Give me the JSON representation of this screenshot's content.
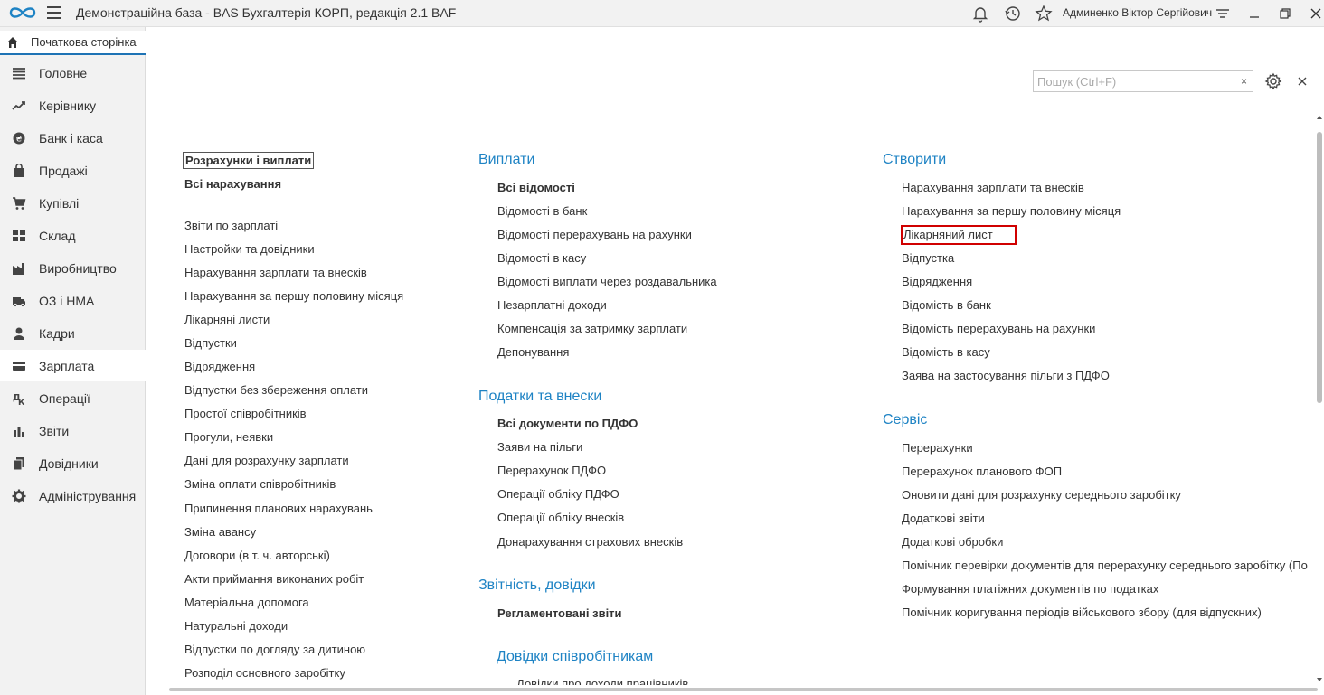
{
  "window": {
    "title": "Демонстраційна база - BAS Бухгалтерія КОРП, редакція 2.1 BAF",
    "user": "Админенко Віктор Сергійович"
  },
  "icons": {
    "logo": "bas-logo-icon",
    "menu": "hamburger-icon",
    "bell": "bell-icon",
    "history": "history-icon",
    "favorites": "star-icon",
    "user_menu": "filter-menu-icon",
    "minimize": "minimize-icon",
    "restore": "restore-icon",
    "close": "close-icon"
  },
  "colors": {
    "accent": "#1e83c4",
    "highlight": "#d00000"
  },
  "sidebar": {
    "home": "Початкова сторінка",
    "items": [
      {
        "label": "Головне",
        "icon": "list-icon"
      },
      {
        "label": "Керівнику",
        "icon": "trend-icon"
      },
      {
        "label": "Банк і каса",
        "icon": "coin-icon"
      },
      {
        "label": "Продажі",
        "icon": "bag-icon"
      },
      {
        "label": "Купівлі",
        "icon": "cart-icon"
      },
      {
        "label": "Склад",
        "icon": "grid-icon"
      },
      {
        "label": "Виробництво",
        "icon": "factory-icon"
      },
      {
        "label": "ОЗ і НМА",
        "icon": "truck-icon"
      },
      {
        "label": "Кадри",
        "icon": "person-icon"
      },
      {
        "label": "Зарплата",
        "icon": "wallet-icon"
      },
      {
        "label": "Операції",
        "icon": "operations-icon"
      },
      {
        "label": "Звіти",
        "icon": "barchart-icon"
      },
      {
        "label": "Довідники",
        "icon": "books-icon"
      },
      {
        "label": "Адміністрування",
        "icon": "gear-icon"
      }
    ]
  },
  "search": {
    "placeholder": "Пошук (Ctrl+F)",
    "clear": "×"
  },
  "col1": {
    "title": "Розрахунки і виплати",
    "bold_link": "Всі нарахування",
    "links": [
      "Звіти по зарплаті",
      "Настройки та довідники",
      "Нарахування зарплати та внесків",
      "Нарахування за першу половину місяця",
      "Лікарняні листи",
      "Відпустки",
      "Відрядження",
      "Відпустки без збереження оплати",
      "Простої співробітників",
      "Прогули, неявки",
      "Дані для розрахунку зарплати",
      "Зміна оплати співробітників",
      "Припинення планових нарахувань",
      "Зміна авансу",
      "Договори (в т. ч. авторські)",
      "Акти приймання виконаних робіт",
      "Матеріальна допомога",
      "Натуральні доходи",
      "Відпустки по догляду за дитиною",
      "Розподіл основного заробітку"
    ]
  },
  "col2": {
    "payments": {
      "title": "Виплати",
      "bold_link": "Всі відомості",
      "links": [
        "Відомості в банк",
        "Відомості перерахувань на рахунки",
        "Відомості в касу",
        "Відомості виплати через роздавальника",
        "Незарплатні доходи",
        "Компенсація за затримку зарплати",
        "Депонування"
      ]
    },
    "taxes": {
      "title": "Податки та внески",
      "bold_link": "Всі документи по ПДФО",
      "links": [
        "Заяви на пільги",
        "Перерахунок ПДФО",
        "Операції обліку ПДФО",
        "Операції обліку внесків",
        "Донарахування страхових внесків"
      ]
    },
    "reports": {
      "title": "Звітність, довідки",
      "bold_link": "Регламентовані звіти"
    },
    "certificates": {
      "title": "Довідки співробітникам",
      "links": [
        "Довідки про доходи працівників"
      ]
    }
  },
  "col3": {
    "create": {
      "title": "Створити",
      "links": [
        "Нарахування зарплати та внесків",
        "Нарахування за першу половину місяця",
        "Лікарняний лист",
        "Відпустка",
        "Відрядження",
        "Відомість в банк",
        "Відомість перерахувань на рахунки",
        "Відомість в касу",
        "Заява на застосування пільги з ПДФО"
      ]
    },
    "service": {
      "title": "Сервіс",
      "links": [
        "Перерахунки",
        "Перерахунок планового ФОП",
        "Оновити дані для розрахунку середнього заробітку",
        "Додаткові звіти",
        "Додаткові обробки",
        "Помічник перевірки документів для перерахунку середнього заробітку (По",
        "Формування платіжних документів по податках",
        "Помічник коригування періодів військового збору (для відпускних)"
      ]
    }
  }
}
